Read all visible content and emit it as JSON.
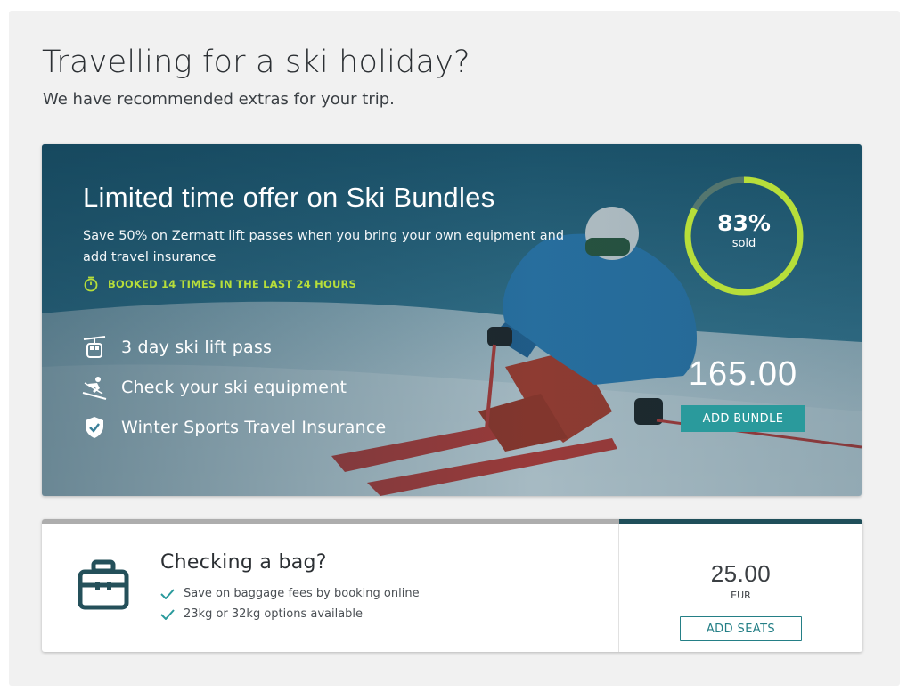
{
  "header": {
    "title": "Travelling for a ski holiday?",
    "subtitle": "We have recommended extras for your trip."
  },
  "ski_bundle": {
    "title": "Limited time offer on Ski Bundles",
    "description": "Save 50% on Zermatt lift passes when you bring your own equipment and add travel insurance",
    "booked_text": "BOOKED 14 TIMES IN THE LAST 24 HOURS",
    "features": [
      {
        "icon": "cable-car-icon",
        "label": "3 day ski lift pass"
      },
      {
        "icon": "skier-icon",
        "label": "Check your ski equipment"
      },
      {
        "icon": "shield-check-icon",
        "label": "Winter Sports Travel Insurance"
      }
    ],
    "sold_percent": 83,
    "sold_percent_label": "83%",
    "sold_label": "sold",
    "price": "165.00",
    "button_label": "ADD BUNDLE",
    "colors": {
      "accent": "#b7de3a",
      "button": "#2a9a9c"
    }
  },
  "baggage": {
    "title": "Checking a bag?",
    "bullets": [
      "Save on baggage fees by booking online",
      "23kg or 32kg options available"
    ],
    "price": "25.00",
    "currency": "EUR",
    "button_label": "ADD SEATS",
    "colors": {
      "icon": "#24505a",
      "check": "#2a9a9c"
    }
  }
}
